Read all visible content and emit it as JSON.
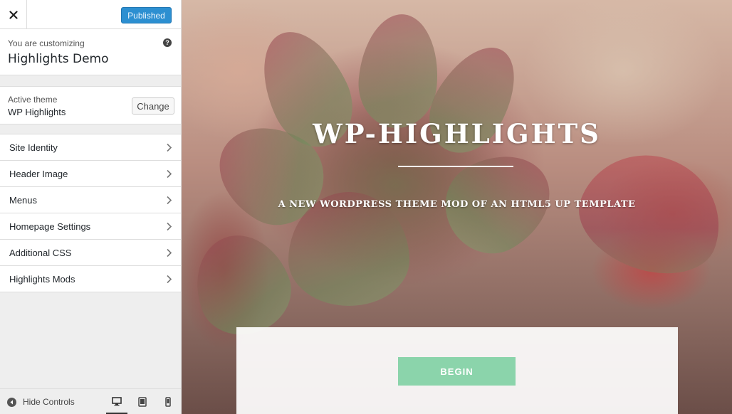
{
  "topbar": {
    "close_icon": "close-icon",
    "publish_label": "Published",
    "publish_color": "#2c8fd1"
  },
  "customizing": {
    "label": "You are customizing",
    "site_name": "Highlights Demo",
    "help_icon": "question-circle-icon"
  },
  "theme": {
    "label": "Active theme",
    "name": "WP Highlights",
    "change_label": "Change"
  },
  "menu": {
    "items": [
      {
        "label": "Site Identity"
      },
      {
        "label": "Header Image"
      },
      {
        "label": "Menus"
      },
      {
        "label": "Homepage Settings"
      },
      {
        "label": "Additional CSS"
      },
      {
        "label": "Highlights Mods"
      }
    ],
    "chevron_icon": "chevron-right-icon"
  },
  "footer": {
    "hide_controls_label": "Hide Controls",
    "devices": [
      "desktop-icon",
      "tablet-icon",
      "mobile-icon"
    ],
    "active_device": "desktop"
  },
  "preview": {
    "title": "WP-HIGHLIGHTS",
    "subtitle": "A NEW WORDPRESS THEME MOD OF AN HTML5 UP TEMPLATE",
    "button_label": "BEGIN",
    "button_color": "#8bd4ab"
  }
}
